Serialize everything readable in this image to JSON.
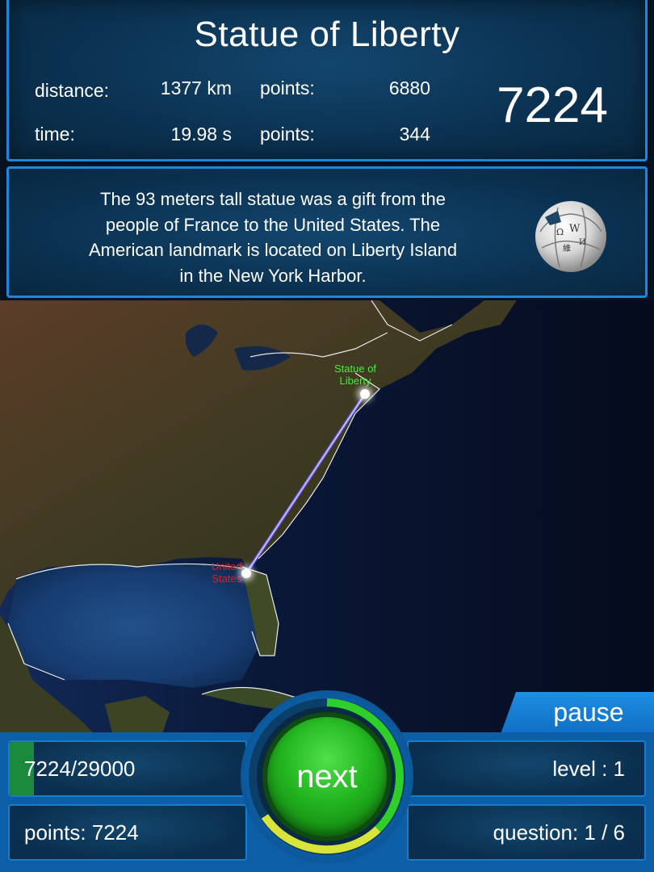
{
  "header": {
    "landmark": "Statue of Liberty",
    "distance_label": "distance:",
    "distance_value": "1377 km",
    "distance_points_label": "points:",
    "distance_points_value": "6880",
    "time_label": "time:",
    "time_value": "19.98 s",
    "time_points_label": "points:",
    "time_points_value": "344",
    "round_score": "7224"
  },
  "info": {
    "fact_lines": [
      "The 93 meters tall statue was a gift from the",
      "people of France to the United States. The",
      "American landmark is located on Liberty Island",
      "in the New York Harbor."
    ],
    "icon": "wikipedia-globe-icon"
  },
  "map": {
    "target_label_line1": "Statue of",
    "target_label_line2": "Liberty",
    "guess_label_line1": "United",
    "guess_label_line2": "States",
    "target_label_color": "#3cf03c",
    "guess_label_color": "#e02020",
    "line_color": "#6a5cff"
  },
  "controls": {
    "pause_label": "pause",
    "next_label": "next"
  },
  "footer": {
    "progress_text": "7224/29000",
    "progress_fraction": 0.249,
    "level_text": "level : 1",
    "points_text": "points: 7224",
    "question_text": "question: 1 / 6"
  }
}
